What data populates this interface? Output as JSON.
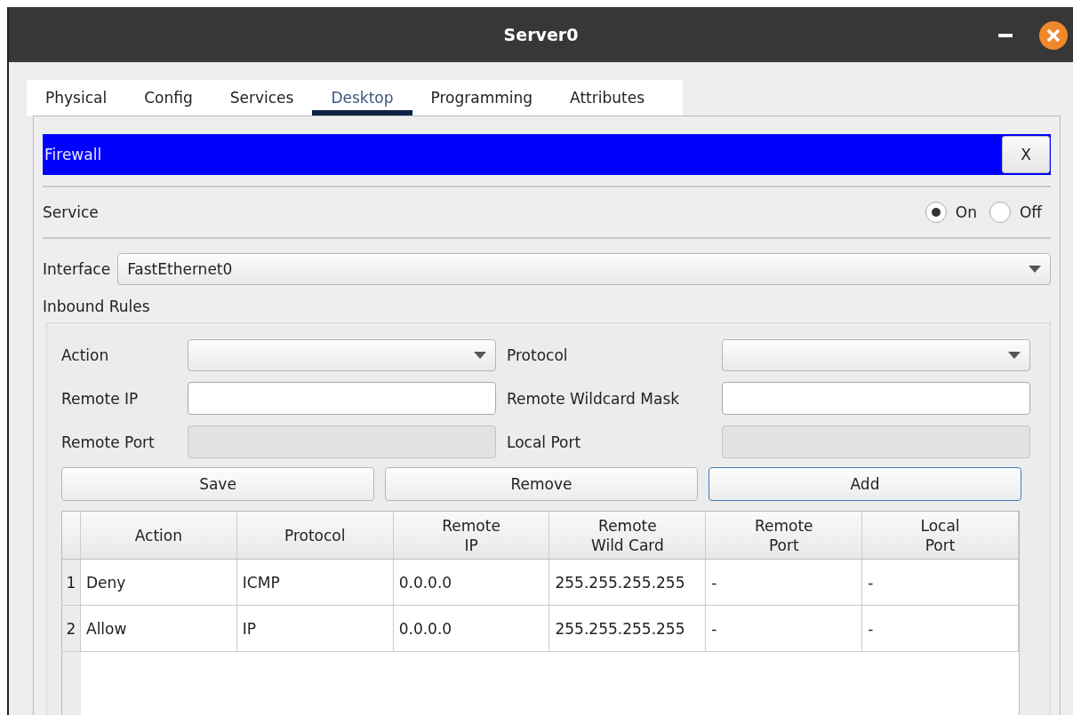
{
  "window": {
    "title": "Server0"
  },
  "tabs": [
    {
      "label": "Physical",
      "selected": false
    },
    {
      "label": "Config",
      "selected": false
    },
    {
      "label": "Services",
      "selected": false
    },
    {
      "label": "Desktop",
      "selected": true
    },
    {
      "label": "Programming",
      "selected": false
    },
    {
      "label": "Attributes",
      "selected": false
    }
  ],
  "panel": {
    "title": "Firewall",
    "close_label": "X"
  },
  "service": {
    "label": "Service",
    "options": [
      {
        "label": "On",
        "selected": true
      },
      {
        "label": "Off",
        "selected": false
      }
    ]
  },
  "interface": {
    "label": "Interface",
    "value": "FastEthernet0"
  },
  "inbound_rules": {
    "title": "Inbound Rules",
    "fields": [
      {
        "label": "Action",
        "kind": "select",
        "disabled": false
      },
      {
        "label": "Protocol",
        "kind": "select",
        "disabled": false
      },
      {
        "label": "Remote IP",
        "kind": "input",
        "disabled": false
      },
      {
        "label": "Remote Wildcard Mask",
        "kind": "input",
        "disabled": false
      },
      {
        "label": "Remote Port",
        "kind": "input",
        "disabled": true
      },
      {
        "label": "Local Port",
        "kind": "input",
        "disabled": true
      }
    ],
    "buttons": [
      {
        "label": "Save",
        "focused": false
      },
      {
        "label": "Remove",
        "focused": false
      },
      {
        "label": "Add",
        "focused": true
      }
    ],
    "table": {
      "columns": [
        "Action",
        "Protocol",
        "Remote\nIP",
        "Remote\nWild Card",
        "Remote\nPort",
        "Local\nPort"
      ],
      "rows": [
        {
          "index": "1",
          "cells": [
            "Deny",
            "ICMP",
            "0.0.0.0",
            "255.255.255.255",
            "-",
            "-"
          ]
        },
        {
          "index": "2",
          "cells": [
            "Allow",
            "IP",
            "0.0.0.0",
            "255.255.255.255",
            "-",
            "-"
          ]
        }
      ]
    }
  }
}
